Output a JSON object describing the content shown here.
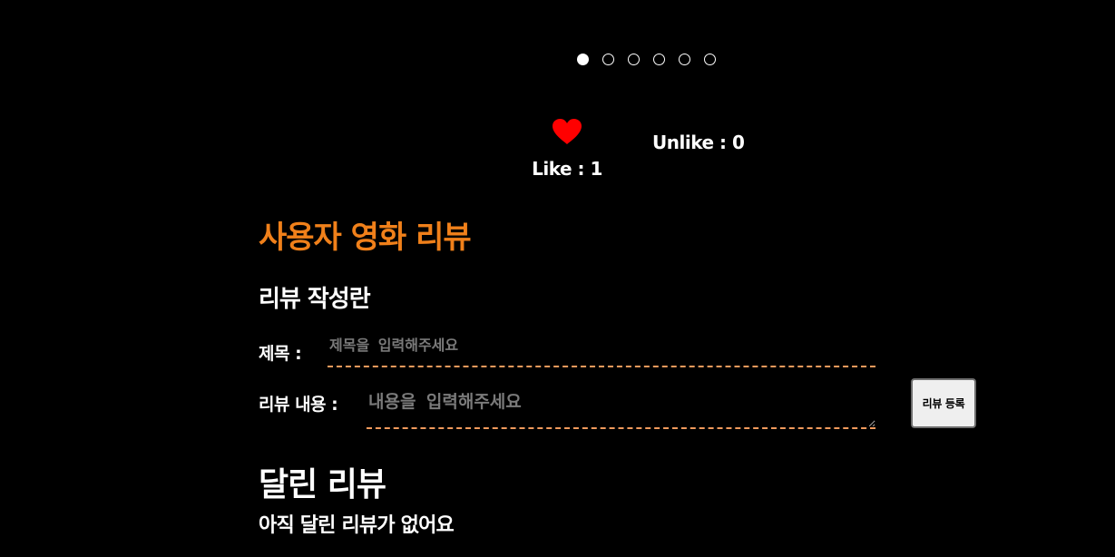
{
  "carousel": {
    "slide_count": 6,
    "active_index": 0
  },
  "reactions": {
    "like_label": "Like : 1",
    "unlike_label": "Unlike : 0",
    "like_icon": "heart-icon",
    "heart_color": "#ff0000"
  },
  "review_section": {
    "title": "사용자 영화 리뷰",
    "title_color": "#f0801a"
  },
  "review_form": {
    "heading": "리뷰 작성란",
    "title_label": "제목 :",
    "title_value": "",
    "title_placeholder": "제목을 입력해주세요",
    "content_label": "리뷰 내용 :",
    "content_value": "",
    "content_placeholder": "내용을 입력해주세요",
    "submit_label": "리뷰 등록",
    "underline_color": "#f29a5c"
  },
  "reviews": {
    "heading": "달린 리뷰",
    "empty_message": "아직 달린 리뷰가 없어요",
    "items": []
  }
}
